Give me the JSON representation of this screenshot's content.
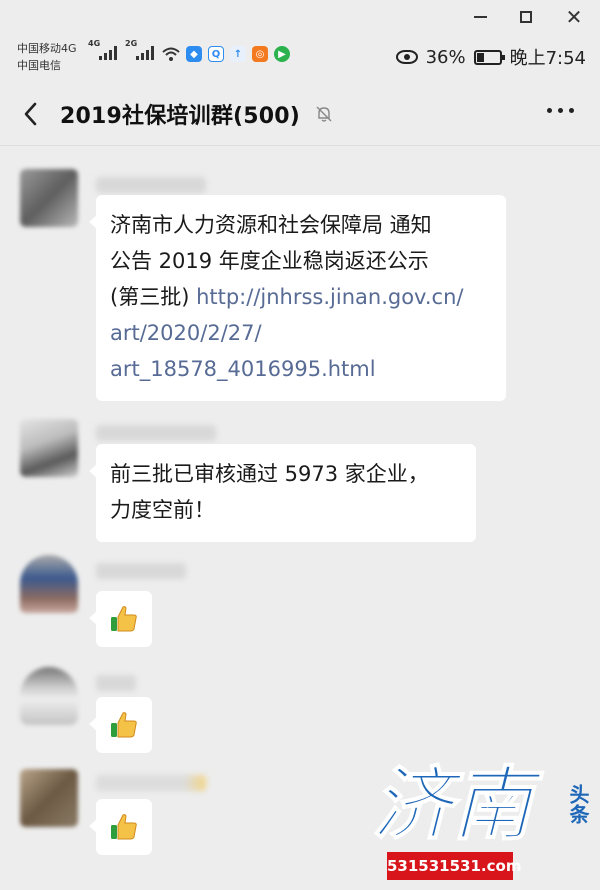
{
  "window": {
    "controls": [
      "minimize",
      "maximize",
      "close"
    ],
    "close_glyph": "✕"
  },
  "status_bar": {
    "carrier_1": "中国移动4G",
    "carrier_2": "中国电信",
    "sig1_tag": "4G",
    "sig2_tag": "2G",
    "battery_percent": "36%",
    "battery_level": 0.36,
    "time": "晚上7:54",
    "icons": [
      "signal-icon",
      "signal-icon",
      "wifi-icon",
      "shield-app-icon",
      "qq-icon",
      "upload-icon",
      "app-icon",
      "video-icon",
      "eye-icon",
      "battery-icon"
    ]
  },
  "header": {
    "title": "2019社保培训群(500)",
    "back_icon": "back-arrow-icon",
    "mute_icon": "bell-muted-icon",
    "more_icon": "more-dots-icon"
  },
  "messages": [
    {
      "type": "text",
      "lines": [
        "济南市人力资源和社会保障局 通知",
        "公告 2019 年度企业稳岗返还公示"
      ],
      "line3_prefix": "(第三批) ",
      "link_lines": [
        "http://jnhrss.jinan.gov.cn/",
        "art/2020/2/27/",
        "art_18578_4016995.html"
      ]
    },
    {
      "type": "text",
      "lines": [
        "前三批已审核通过 5973 家企业，",
        "力度空前！"
      ]
    },
    {
      "type": "emoji",
      "emoji": "thumbs-up-icon"
    },
    {
      "type": "emoji",
      "emoji": "thumbs-up-icon"
    },
    {
      "type": "emoji",
      "emoji": "thumbs-up-icon"
    }
  ],
  "watermark": {
    "brand": "济南",
    "side_text": "头条",
    "site": "531531531.com",
    "brand_color": "#1e67b8",
    "site_bg": "#d9151c"
  },
  "colors": {
    "background": "#ededed",
    "bubble": "#ffffff",
    "link": "#576b95"
  }
}
